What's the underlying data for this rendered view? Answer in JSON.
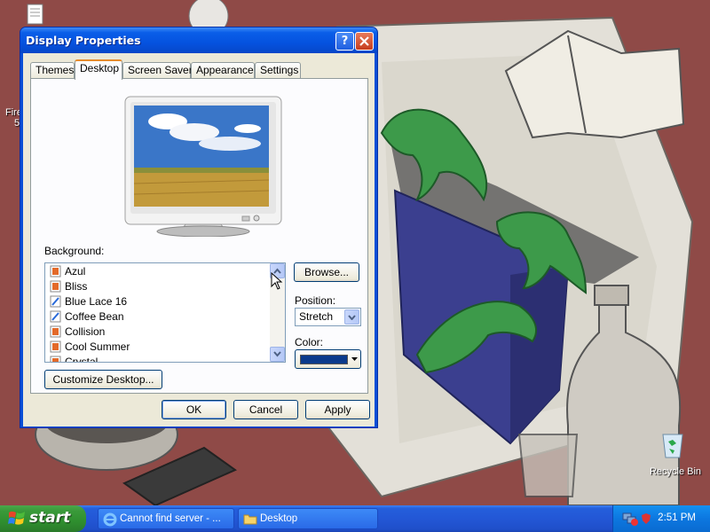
{
  "desktop": {
    "icons": [
      {
        "label": "Fire",
        "sub": "5",
        "icon": "document-icon"
      },
      {
        "label": "Recycle Bin",
        "icon": "recycle-bin-icon"
      }
    ]
  },
  "window": {
    "title": "Display Properties",
    "help_label": "?",
    "tabs": [
      {
        "label": "Themes"
      },
      {
        "label": "Desktop"
      },
      {
        "label": "Screen Saver"
      },
      {
        "label": "Appearance"
      },
      {
        "label": "Settings"
      }
    ],
    "active_tab": "Desktop",
    "background_label": "Background:",
    "backgrounds": [
      {
        "name": "Azul"
      },
      {
        "name": "Bliss"
      },
      {
        "name": "Blue Lace 16"
      },
      {
        "name": "Coffee Bean"
      },
      {
        "name": "Collision"
      },
      {
        "name": "Cool Summer"
      },
      {
        "name": "Crystal"
      }
    ],
    "browse_label": "Browse...",
    "position_label": "Position:",
    "position_value": "Stretch",
    "color_label": "Color:",
    "color_value": "#0a3a8c",
    "customize_label": "Customize Desktop...",
    "ok_label": "OK",
    "cancel_label": "Cancel",
    "apply_label": "Apply"
  },
  "taskbar": {
    "start_label": "start",
    "tasks": [
      {
        "label": "Cannot find server - ...",
        "icon": "ie-icon"
      },
      {
        "label": "Desktop",
        "icon": "folder-icon"
      }
    ],
    "clock": "2:51 PM"
  },
  "colors": {
    "wallpaper_red": "#8f4a47",
    "xp_blue": "#0a4fd6",
    "start_green": "#3a9a3a",
    "dialog_bg": "#ece9d8"
  }
}
